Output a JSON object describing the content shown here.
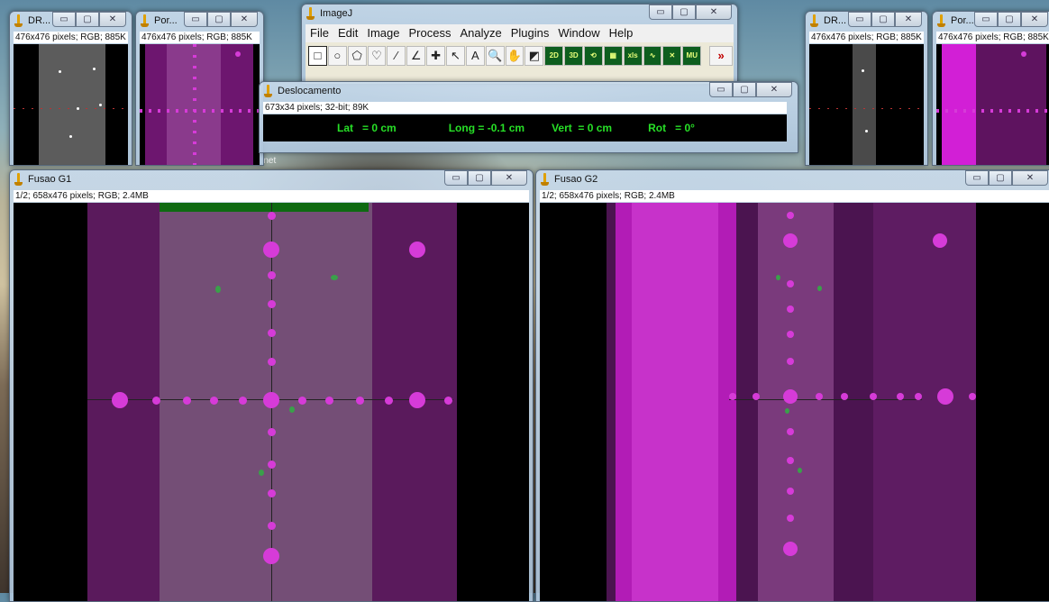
{
  "desktop": {
    "partial_label": "rnet"
  },
  "windows": {
    "dr_left": {
      "title": "DR...",
      "info": "476x476 pixels; RGB; 885K"
    },
    "por_left": {
      "title": "Por...",
      "info": "476x476 pixels; RGB; 885K"
    },
    "dr_right": {
      "title": "DR...",
      "info": "476x476 pixels; RGB; 885K"
    },
    "por_right": {
      "title": "Por...",
      "info": "476x476 pixels; RGB; 885K"
    },
    "fusao_g1": {
      "title": "Fusao G1",
      "info": "1/2; 658x476 pixels; RGB; 2.4MB"
    },
    "fusao_g2": {
      "title": "Fusao G2",
      "info": "1/2; 658x476 pixels; RGB; 2.4MB"
    }
  },
  "imagej": {
    "title": "ImageJ",
    "menu": [
      "File",
      "Edit",
      "Image",
      "Process",
      "Analyze",
      "Plugins",
      "Window",
      "Help"
    ],
    "tools": [
      {
        "icon": "rectangle-icon",
        "glyph": "□"
      },
      {
        "icon": "oval-icon",
        "glyph": "○"
      },
      {
        "icon": "polygon-icon",
        "glyph": "⬠"
      },
      {
        "icon": "freehand-icon",
        "glyph": "♡"
      },
      {
        "icon": "straight-line-icon",
        "glyph": "⁄"
      },
      {
        "icon": "angle-icon",
        "glyph": "∠"
      },
      {
        "icon": "point-icon",
        "glyph": "✚"
      },
      {
        "icon": "wand-icon",
        "glyph": "↖"
      },
      {
        "icon": "text-icon",
        "glyph": "A"
      },
      {
        "icon": "magnifier-icon",
        "glyph": "🔍"
      },
      {
        "icon": "hand-icon",
        "glyph": "✋"
      },
      {
        "icon": "color-picker-icon",
        "glyph": "◩"
      },
      {
        "icon": "plugin-2d-icon",
        "glyph": "2D"
      },
      {
        "icon": "plugin-3d-icon",
        "glyph": "3D"
      },
      {
        "icon": "plugin-rotate-icon",
        "glyph": "⟲"
      },
      {
        "icon": "plugin-grid-icon",
        "glyph": "▦"
      },
      {
        "icon": "plugin-xls-icon",
        "glyph": "xls"
      },
      {
        "icon": "plugin-curve-icon",
        "glyph": "∿"
      },
      {
        "icon": "plugin-cross-icon",
        "glyph": "✕"
      },
      {
        "icon": "plugin-mu-icon",
        "glyph": "MU"
      }
    ],
    "more_tools": "»"
  },
  "deslocamento": {
    "title": "Deslocamento",
    "info": "673x34 pixels; 32-bit; 89K",
    "lat": "Lat   = 0 cm",
    "long": "Long = -0.1 cm",
    "vert": "Vert  = 0 cm",
    "rot": "Rot   = 0°"
  },
  "colors": {
    "readout_text": "#27e027",
    "magenta": "#c21bc7",
    "dot": "#d63bd8"
  }
}
